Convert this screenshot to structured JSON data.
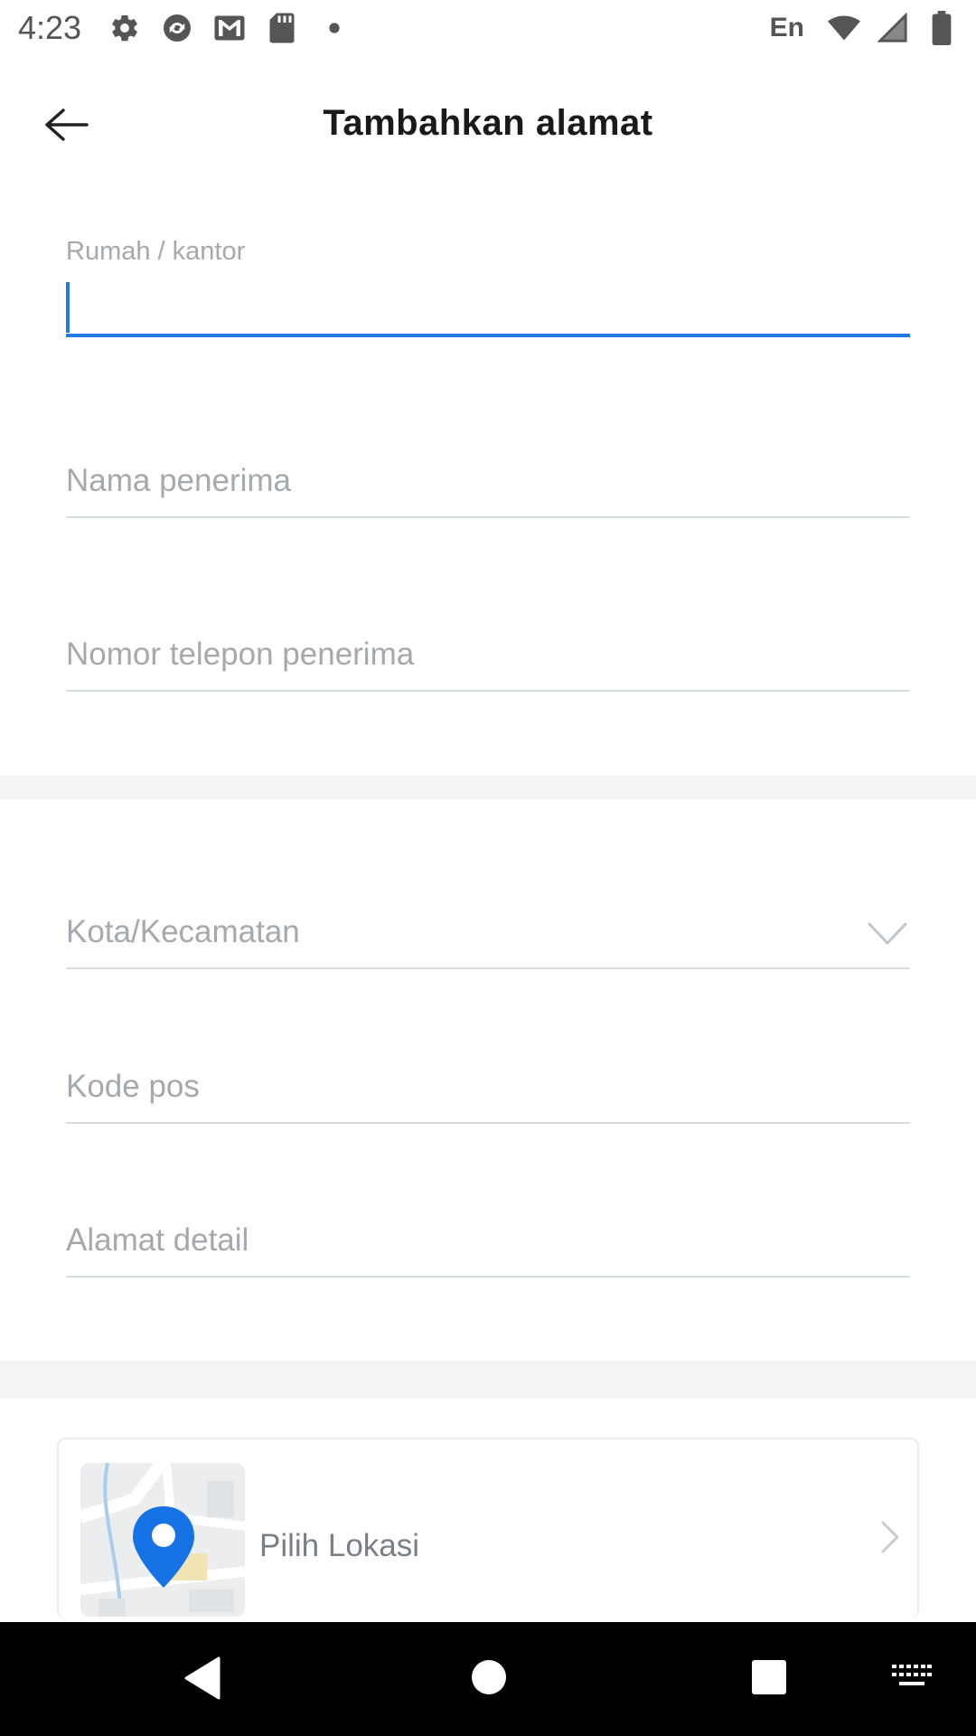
{
  "status_bar": {
    "time": "4:23",
    "lang": "En",
    "icons_left": [
      "gear-icon",
      "sync-icon",
      "mail-icon",
      "sd-card-icon",
      "dot-icon"
    ],
    "icons_right": [
      "wifi-icon",
      "signal-icon",
      "battery-icon"
    ]
  },
  "header": {
    "title": "Tambahkan alamat",
    "back_icon": "arrow-left-icon"
  },
  "form": {
    "label_field": {
      "label": "Rumah / kantor",
      "value": ""
    },
    "recipient_name": {
      "placeholder": "Nama penerima",
      "value": ""
    },
    "recipient_phone": {
      "placeholder": "Nomor telepon penerima",
      "value": ""
    },
    "city_district": {
      "placeholder": "Kota/Kecamatan",
      "value": "",
      "icon": "chevron-down-icon"
    },
    "postal_code": {
      "placeholder": "Kode pos",
      "value": ""
    },
    "address_detail": {
      "placeholder": "Alamat detail",
      "value": ""
    }
  },
  "location": {
    "label": "Pilih Lokasi",
    "icon": "map-pin-icon",
    "chevron": "chevron-right-icon"
  },
  "nav_bar": {
    "buttons": [
      "back-triangle-icon",
      "home-circle-icon",
      "recents-square-icon",
      "keyboard-icon"
    ]
  },
  "colors": {
    "accent": "#1f7be3",
    "placeholder": "#a4a9ad",
    "divider": "#d6dde3",
    "band": "#f3f4f5"
  }
}
